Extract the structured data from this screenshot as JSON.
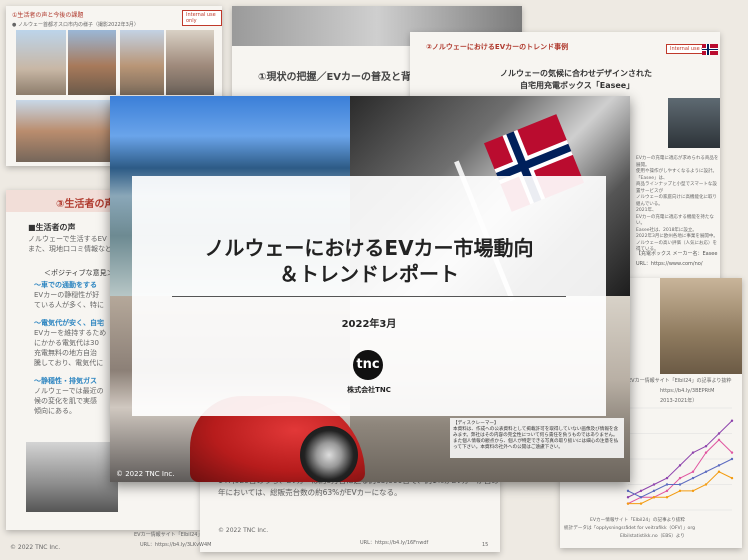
{
  "slides": {
    "top_left": {
      "heading": "①生活者の声と今後の課題",
      "sub": "● ノルウェー首都オスロ市内の様子（撮影2022年3月）",
      "tag": "Internal use only"
    },
    "top_center": {
      "heading": "①現状の把握／EVカーの普及と背景"
    },
    "top_right": {
      "heading": "②ノルウェーにおけるEVカーのトレンド事例",
      "tag": "Internal use only",
      "title_line1": "ノルウェーの気候に合わせデザインされた",
      "title_line2": "自宅用充電ボックス「Easee」",
      "body": [
        "EVカーの充電に適応が求められる商品を展開。",
        "使用や操作がしやすくなるように設計。「Easee」は、",
        "商品ラインナップと小型でスマートな設置サービスが",
        "ノルウェーの家庭向けに高機能化に取り組んでいる。",
        "2021年、",
        "EVカーの充電に適応する機能を持たない。",
        "Easee社は、2018年に設立。",
        "2022年3月に欧州各地に事業を展開中。",
        "ノルウェーの高い評価（人気にお応）を得ている。"
      ],
      "maker_label": "【充電ボックス メーカー名：Easee",
      "url_label": "URL：https://www.com/no/"
    },
    "left_mid": {
      "heading": "③生活者の声",
      "label": "■生活者の声",
      "line1": "ノルウェーで生活するEV",
      "line2": "また、現地口コミ情報など",
      "positive": "＜ポジティブな意見＞",
      "p1_head": "〜車での通勤をする",
      "p1_body1": "EVカーの静穏性が好",
      "p1_body2": "ている人が多く、特に",
      "p2_head": "〜電気代が安く、自宅",
      "p2_body1": "EVカーを維持するため",
      "p2_body2": "にかかる電気代は30",
      "p2_body3": "充電無料の地方自治",
      "p2_body4": "騰しており、電気代に",
      "p3_head": "〜静穏性・排気ガス",
      "p3_body1": "ノルウェーでは最近の",
      "p3_body2": "候の変化を肌で実感",
      "p3_body3": "傾向にある。"
    },
    "bottom": {
      "text1": "147,929台のうち、EVカーは約8万台に迫る約65,000台で、約1%がEVカーが占めている。2021",
      "text2": "年においては、総販売台数の約63%がEVカーになる。",
      "copyright": "© 2022 TNC Inc.",
      "source1": "EVカー情報サイト「Elbil24」",
      "url1": "URL：https://b4.ly/3LKvW4M",
      "url2": "URL：https://b4.ly/16Fnwdf",
      "page": "15"
    },
    "right_bottom": {
      "note1": "EVカー情報サイト「Elbil24」の記事より抜粋",
      "note2": "https://b4.ly/3BEPRtM",
      "note3": "2013-2021年）",
      "src_line1": "EVカー情報サイト「Elbil24」の記事より抜粋",
      "src_line2": "統計データは「opplysningsrådet for veitrafikk（OFV）」org",
      "src_line3": "Elbilstatistikk.no（EBS）より"
    }
  },
  "main": {
    "title_line1": "ノルウェーにおけるEVカー市場動向",
    "title_line2": "＆トレンドレポート",
    "date": "2022年3月",
    "logo": "tnc",
    "company": "株式会社TNC",
    "copyright": "© 2022 TNC Inc.",
    "disclaimer_label": "【ディスクレーマー】",
    "disclaimer": "本資料は、作成への公表資料として掲載許可を取得していない画像及び情報を含みます。弊社はその内容の完全性について何ら責任を負うものではありません。また個人情報の観点から、個人が特定できる写真の取り扱いには細心の注意を払って下さい。本資料の社外への公開はご遠慮下さい。"
  },
  "chart_data": {
    "type": "line",
    "title": "",
    "x": [
      "",
      "",
      "",
      "",
      "",
      "",
      "",
      "",
      ""
    ],
    "series": [
      {
        "values": [
          2,
          3,
          4,
          5,
          7,
          9,
          10,
          12,
          14
        ],
        "color": "#8e44ad"
      },
      {
        "values": [
          1,
          2,
          2,
          3,
          5,
          6,
          9,
          11,
          9
        ],
        "color": "#e056a0"
      },
      {
        "values": [
          3,
          2,
          3,
          4,
          4,
          5,
          6,
          7,
          8
        ],
        "color": "#5c6bc0"
      },
      {
        "values": [
          1,
          1,
          2,
          2,
          3,
          3,
          4,
          6,
          5
        ],
        "color": "#f39c12"
      }
    ],
    "ylim": [
      0,
      16
    ],
    "grid": true
  }
}
